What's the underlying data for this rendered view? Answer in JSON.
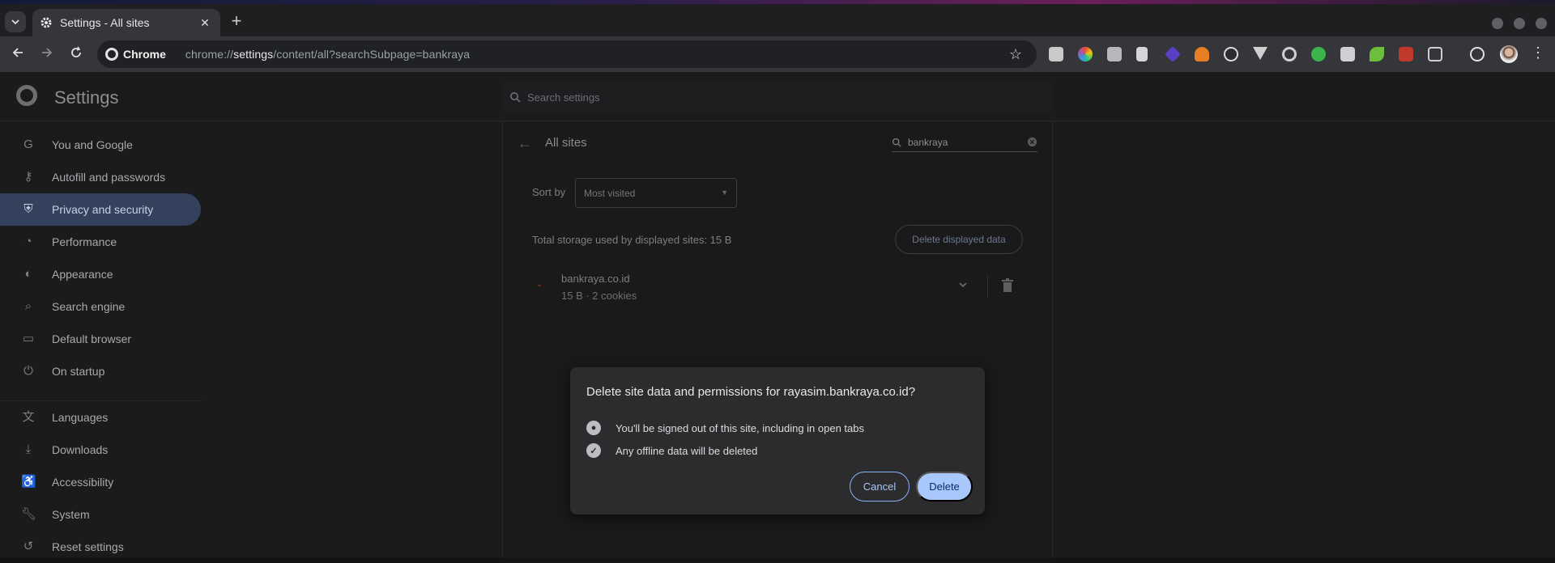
{
  "browser": {
    "tab_title": "Settings - All sites",
    "chip_label": "Chrome",
    "url_prefix": "chrome://",
    "url_host": "settings",
    "url_path": "/content/all?searchSubpage=bankraya"
  },
  "settings": {
    "title": "Settings",
    "search_placeholder": "Search settings"
  },
  "sidebar": {
    "items": [
      {
        "label": "You and Google",
        "icon": "google-icon"
      },
      {
        "label": "Autofill and passwords",
        "icon": "key-icon"
      },
      {
        "label": "Privacy and security",
        "icon": "shield-icon",
        "active": true
      },
      {
        "label": "Performance",
        "icon": "speedometer-icon"
      },
      {
        "label": "Appearance",
        "icon": "palette-icon"
      },
      {
        "label": "Search engine",
        "icon": "search-icon"
      },
      {
        "label": "Default browser",
        "icon": "browser-window-icon"
      },
      {
        "label": "On startup",
        "icon": "power-icon"
      },
      {
        "label": "Languages",
        "icon": "translate-icon"
      },
      {
        "label": "Downloads",
        "icon": "download-icon"
      },
      {
        "label": "Accessibility",
        "icon": "accessibility-icon"
      },
      {
        "label": "System",
        "icon": "wrench-icon"
      },
      {
        "label": "Reset settings",
        "icon": "reset-icon"
      }
    ]
  },
  "all_sites": {
    "title": "All sites",
    "filter_value": "bankraya",
    "sort_label": "Sort by",
    "sort_value": "Most visited",
    "storage_text": "Total storage used by displayed sites: 15 B",
    "delete_displayed_label": "Delete displayed data",
    "site": {
      "name": "bankraya.co.id",
      "info": "15 B · 2 cookies"
    }
  },
  "dialog": {
    "title": "Delete site data and permissions for rayasim.bankraya.co.id?",
    "line1": "You'll be signed out of this site, including in open tabs",
    "line2": "Any offline data will be deleted",
    "cancel_label": "Cancel",
    "delete_label": "Delete"
  },
  "colors": {
    "accent": "#a8c7fa",
    "active_nav_bg": "#33415c"
  }
}
